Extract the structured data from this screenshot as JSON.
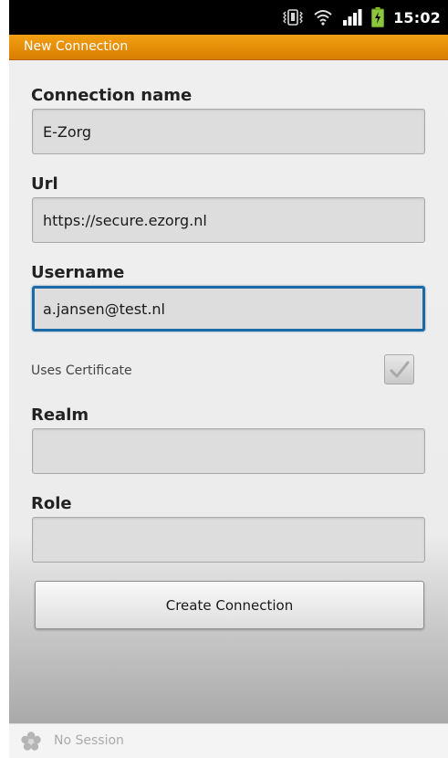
{
  "status_bar": {
    "time": "15:02",
    "icons": [
      "vibrate-icon",
      "wifi-icon",
      "signal-icon",
      "battery-charging-icon"
    ]
  },
  "title_bar": {
    "title": "New Connection",
    "color": "#e88a00"
  },
  "form": {
    "connection_name": {
      "label": "Connection name",
      "value": "E-Zorg"
    },
    "url": {
      "label": "Url",
      "value": "https://secure.ezorg.nl"
    },
    "username": {
      "label": "Username",
      "value": "a.jansen@test.nl"
    },
    "uses_certificate": {
      "label": "Uses Certificate",
      "checked": true,
      "enabled": false
    },
    "realm": {
      "label": "Realm",
      "value": ""
    },
    "role": {
      "label": "Role",
      "value": ""
    },
    "submit_label": "Create Connection"
  },
  "bottom_bar": {
    "session_text": "No Session",
    "icon": "session-icon"
  },
  "colors": {
    "accent": "#e88a00",
    "focus": "#1b6aa5"
  }
}
